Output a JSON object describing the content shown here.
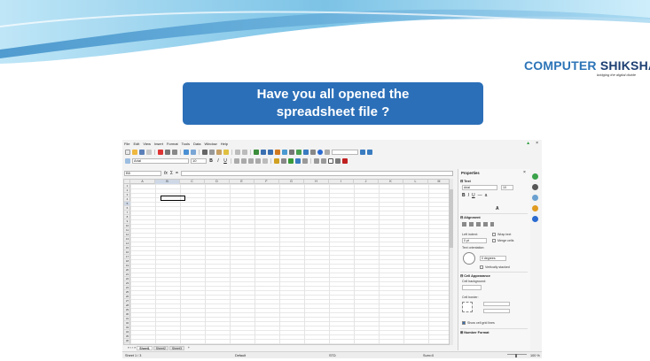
{
  "slide": {
    "callout_line1": "Have you all opened the",
    "callout_line2": "spreadsheet file ?",
    "logo_part1": "COMPUTER",
    "logo_part2": "SHIKSHA",
    "logo_tagline": "bridging the digital divide",
    "colors": {
      "callout_bg": "#2b6fb8",
      "logo_blue": "#2c74b7",
      "logo_navy": "#1d3f73"
    }
  },
  "app": {
    "menus": [
      "File",
      "Edit",
      "View",
      "Insert",
      "Format",
      "Tools",
      "Data",
      "Window",
      "Help"
    ],
    "font_name": "Arial",
    "font_size": "10",
    "format_buttons": [
      "B",
      "I",
      "U"
    ],
    "name_box": "B5",
    "formula_icons": [
      "fx",
      "Σ",
      "="
    ],
    "columns": [
      "A",
      "B",
      "C",
      "D",
      "E",
      "F",
      "G",
      "H",
      "I",
      "J",
      "K",
      "L",
      "M"
    ],
    "rows": [
      "1",
      "2",
      "3",
      "4",
      "5",
      "6",
      "7",
      "8",
      "9",
      "10",
      "11",
      "12",
      "13",
      "14",
      "15",
      "16",
      "17",
      "18",
      "19",
      "20",
      "21",
      "22",
      "23",
      "24",
      "25",
      "26",
      "27",
      "28",
      "29",
      "30",
      "31",
      "32",
      "33",
      "34",
      "35",
      "36"
    ],
    "sheet_tabs": [
      "Sheet1",
      "Sheet2",
      "Sheet3"
    ],
    "status": {
      "sheet": "Sheet 1 / 3",
      "style": "Default",
      "lang": "STD",
      "sum": "Sum=0",
      "zoom": "100 %"
    }
  },
  "sidebar": {
    "title": "Properties",
    "text_section": "Text",
    "font": "Arial",
    "size": "10",
    "alignment_section": "Alignment",
    "left_indent_label": "Left indent:",
    "indent_value": "0 pt",
    "wrap_text": "Wrap text",
    "merge_cells": "Merge cells",
    "text_orientation": "Text orientation:",
    "degrees": "0 degrees",
    "vertically_stacked": "Vertically stacked",
    "cell_appearance": "Cell Appearance",
    "cell_background": "Cell background:",
    "cell_border": "Cell border:",
    "show_grid": "Show cell grid lines",
    "number_format": "Number Format"
  }
}
